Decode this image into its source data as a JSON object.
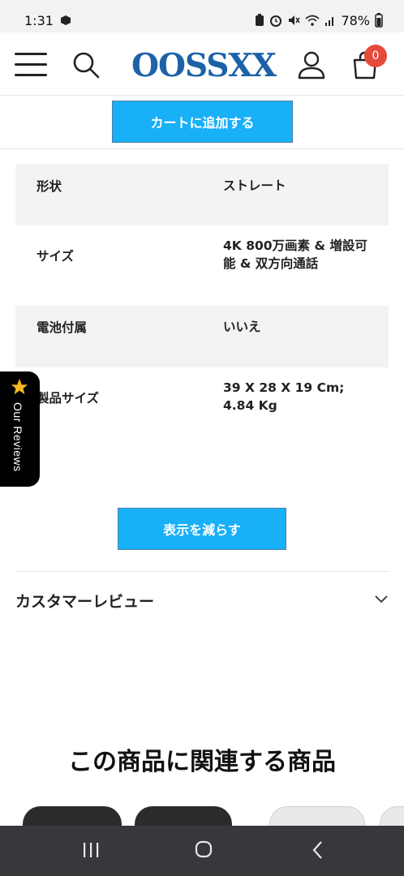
{
  "status_bar": {
    "time": "1:31",
    "battery": "78%"
  },
  "header": {
    "logo": "OOSSXX",
    "cart_count": "0",
    "icons": [
      "menu-icon",
      "search-icon",
      "user-icon",
      "cart-icon"
    ]
  },
  "add_to_cart": {
    "label": "カートに追加する"
  },
  "specs": [
    {
      "label": "形状",
      "value": "ストレート"
    },
    {
      "label": "サイズ",
      "value": "4K 800万画素 & 増設可能 & 双方向通話"
    },
    {
      "label": "電池付属",
      "value": "いいえ"
    },
    {
      "label": "製品サイズ",
      "value": "39 X 28 X 19 Cm; 4.84 Kg"
    }
  ],
  "reviews_tab": {
    "label": "Our Reviews"
  },
  "show_less": {
    "label": "表示を減らす"
  },
  "customer_reviews": {
    "title": "カスタマーレビュー"
  },
  "related": {
    "title": "この商品に関連する商品"
  },
  "colors": {
    "accent": "#18b0f7",
    "logo": "#1d62a8",
    "badge": "#e64a3c",
    "nav_bar": "#36383c"
  }
}
